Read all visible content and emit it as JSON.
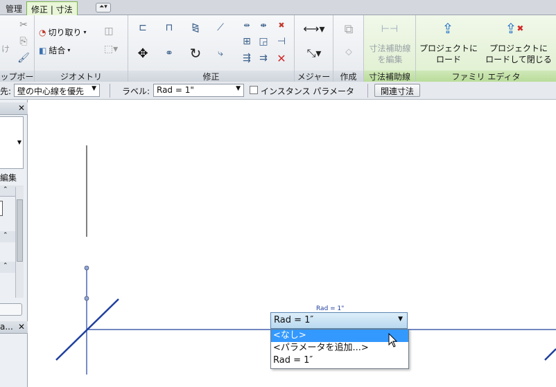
{
  "tabs": [
    "管理",
    "修正 | 寸法"
  ],
  "active_tab": "修正 | 寸法",
  "quick_access": "⏶▾",
  "ribbon": {
    "panels": [
      {
        "title": "ップボード"
      },
      {
        "title": "ジオメトリ"
      },
      {
        "title": "修正"
      },
      {
        "title": "メジャー"
      },
      {
        "title": "作成"
      },
      {
        "title": "寸法補助線"
      },
      {
        "title": "ファミリ エディタ"
      }
    ],
    "clipboard_partial": "け",
    "geometry": {
      "cut_label": "切り取り",
      "join_label": "結合"
    },
    "dim_aux": {
      "edit_label_1": "寸法補助線",
      "edit_label_2": "を編集"
    },
    "family_editor": {
      "load_label_1": "プロジェクトに",
      "load_label_2": "ロード",
      "load_close_label_1": "プロジェクトに",
      "load_close_label_2": "ロードして閉じる"
    }
  },
  "options_bar": {
    "priority_label": "先:",
    "priority_value": "壁の中心線を優先",
    "label_caption": "ラベル:",
    "label_value": "Rad = 1\"",
    "instance_param_label": "インスタンス パラメータ",
    "instance_param_checked": false,
    "related_dim_button": "関連寸法"
  },
  "left_panel": {
    "edit_label": "編集",
    "bottom_label": "a..."
  },
  "canvas": {
    "dim_text": "Rad = 1\"",
    "combo_value": "Rad = 1″",
    "dropdown_options": [
      "<なし>",
      "<パラメータを追加...>",
      "Rad = 1″"
    ],
    "highlighted_option": 0,
    "line_color": "#1f3f9e"
  }
}
